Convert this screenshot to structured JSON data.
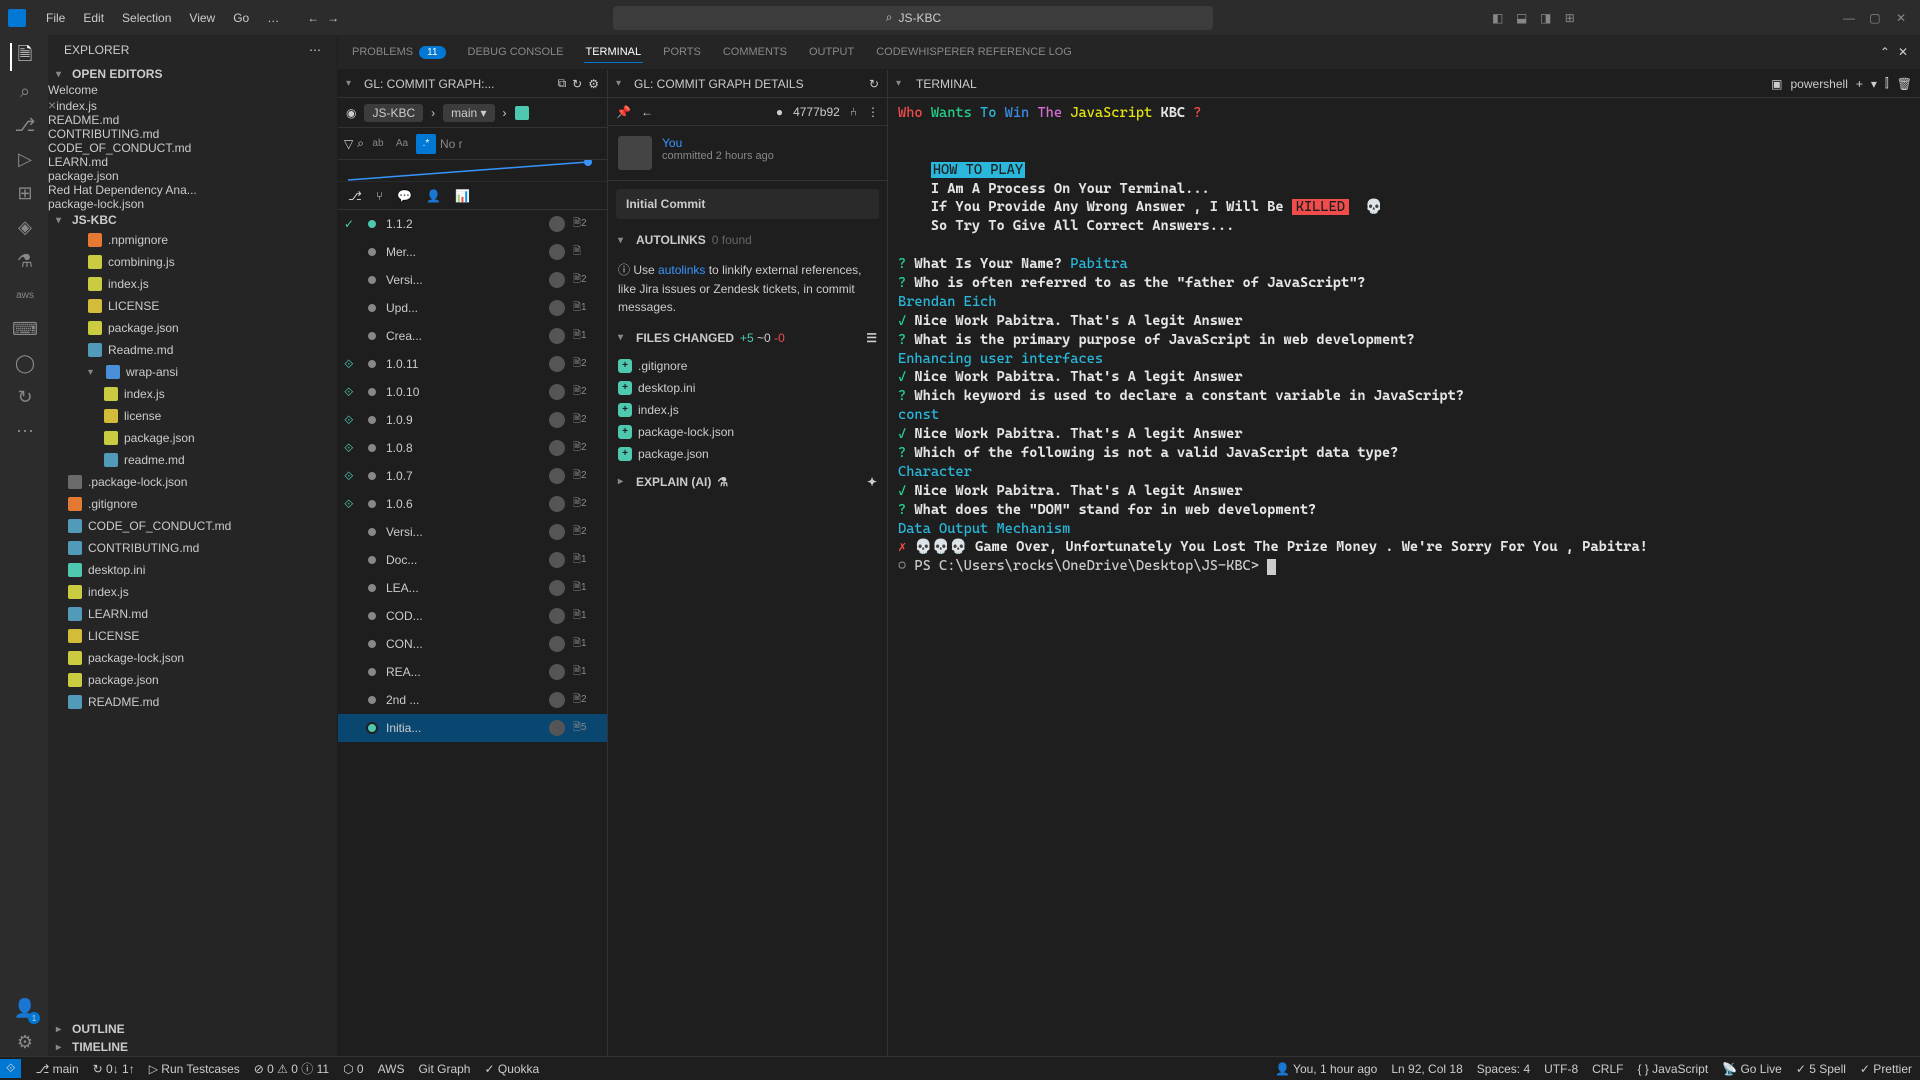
{
  "titlebar": {
    "menus": [
      "File",
      "Edit",
      "Selection",
      "View",
      "Go",
      "…"
    ],
    "search": "JS-KBC",
    "search_icon": "⌕"
  },
  "activitybar": {
    "items": [
      "files",
      "search",
      "scm",
      "debug",
      "ext",
      "remote",
      "testing",
      "aws",
      "terminal",
      "chat",
      "cloud"
    ],
    "bottom": [
      "account",
      "gear"
    ]
  },
  "explorer": {
    "title": "EXPLORER",
    "open_editors": "OPEN EDITORS",
    "open_items": [
      {
        "icon": "blue",
        "label": "Welcome",
        "close": false
      },
      {
        "icon": "js",
        "label": "index.js",
        "close": true
      },
      {
        "icon": "md",
        "label": "README.md",
        "invalid": true
      },
      {
        "icon": "md",
        "label": "CONTRIBUTING.md",
        "invalid": true
      },
      {
        "icon": "md",
        "label": "CODE_OF_CONDUCT.md",
        "invalid": true
      },
      {
        "icon": "md",
        "label": "LEARN.md",
        "invalid": true
      },
      {
        "icon": "json",
        "label": "package.json",
        "invalid": true
      },
      {
        "icon": "invalid",
        "label": "Red Hat Dependency Ana...",
        "invalid": true
      },
      {
        "icon": "json",
        "label": "package-lock.json",
        "invalid": true
      }
    ],
    "project": "JS-KBC",
    "files": [
      {
        "l": 2,
        "icon": "git",
        "label": ".npmignore"
      },
      {
        "l": 2,
        "icon": "js",
        "label": "combining.js"
      },
      {
        "l": 2,
        "icon": "js",
        "label": "index.js"
      },
      {
        "l": 2,
        "icon": "license",
        "label": "LICENSE"
      },
      {
        "l": 2,
        "icon": "json",
        "label": "package.json"
      },
      {
        "l": 2,
        "icon": "md",
        "label": "Readme.md"
      },
      {
        "l": 2,
        "chev": "▾",
        "icon": "folder",
        "label": "wrap-ansi"
      },
      {
        "l": 3,
        "icon": "js",
        "label": "index.js"
      },
      {
        "l": 3,
        "icon": "license",
        "label": "license"
      },
      {
        "l": 3,
        "icon": "json",
        "label": "package.json"
      },
      {
        "l": 3,
        "icon": "md",
        "label": "readme.md"
      },
      {
        "l": 1,
        "icon": "lock",
        "label": ".package-lock.json"
      },
      {
        "l": 1,
        "icon": "git",
        "label": ".gitignore"
      },
      {
        "l": 1,
        "icon": "md",
        "label": "CODE_OF_CONDUCT.md"
      },
      {
        "l": 1,
        "icon": "md",
        "label": "CONTRIBUTING.md"
      },
      {
        "l": 1,
        "icon": "green",
        "label": "desktop.ini"
      },
      {
        "l": 1,
        "icon": "js",
        "label": "index.js"
      },
      {
        "l": 1,
        "icon": "md",
        "label": "LEARN.md"
      },
      {
        "l": 1,
        "icon": "license",
        "label": "LICENSE"
      },
      {
        "l": 1,
        "icon": "json",
        "label": "package-lock.json"
      },
      {
        "l": 1,
        "icon": "json",
        "label": "package.json"
      },
      {
        "l": 1,
        "icon": "md",
        "label": "README.md"
      }
    ],
    "sections": {
      "outline": "OUTLINE",
      "timeline": "TIMELINE"
    }
  },
  "panel_tabs": {
    "items": [
      "PROBLEMS",
      "DEBUG CONSOLE",
      "TERMINAL",
      "PORTS",
      "COMMENTS",
      "OUTPUT",
      "CODEWHISPERER REFERENCE LOG"
    ],
    "active": 2,
    "problems_badge": "11"
  },
  "graph": {
    "title": "GL: COMMIT GRAPH:...",
    "repo": "JS-KBC",
    "branch": "main",
    "search_placeholder": "No r",
    "opts": {
      "match": "ab",
      "case": "Aa",
      "regex": ".*"
    },
    "commits": [
      {
        "msg": "1.1.2",
        "cnt": 2,
        "check": true
      },
      {
        "msg": "Mer...",
        "cnt": "",
        "av": true
      },
      {
        "msg": "Versi...",
        "cnt": 2
      },
      {
        "msg": "Upd...",
        "cnt": 1
      },
      {
        "msg": "Crea...",
        "cnt": 1
      },
      {
        "msg": "1.0.11",
        "cnt": 2,
        "link": true
      },
      {
        "msg": "1.0.10",
        "cnt": 2,
        "link": true
      },
      {
        "msg": "1.0.9",
        "cnt": 2,
        "link": true
      },
      {
        "msg": "1.0.8",
        "cnt": 2,
        "link": true
      },
      {
        "msg": "1.0.7",
        "cnt": 2,
        "link": true
      },
      {
        "msg": "1.0.6",
        "cnt": 2,
        "link": true
      },
      {
        "msg": "Versi...",
        "cnt": 2
      },
      {
        "msg": "Doc...",
        "cnt": 1
      },
      {
        "msg": "LEA...",
        "cnt": 1
      },
      {
        "msg": "COD...",
        "cnt": 1
      },
      {
        "msg": "CON...",
        "cnt": 1
      },
      {
        "msg": "REA...",
        "cnt": 1
      },
      {
        "msg": "2nd ...",
        "cnt": 2
      },
      {
        "msg": "Initia...",
        "cnt": 5,
        "sel": true
      }
    ]
  },
  "details": {
    "title": "GL: COMMIT GRAPH DETAILS",
    "hash": "4777b92",
    "author": "You",
    "time": "committed 2 hours ago",
    "commit_title": "Initial Commit",
    "autolinks": {
      "label": "AUTOLINKS",
      "count": "0 found",
      "text_pre": "ⓘ Use ",
      "link": "autolinks",
      "text_post": " to linkify external references, like Jira issues or Zendesk tickets, in commit messages."
    },
    "files": {
      "label": "FILES CHANGED",
      "stats_add": "+5",
      "stats_mod": "~0",
      "stats_del": "-0",
      "list": [
        ".gitignore",
        "desktop.ini",
        "index.js",
        "package-lock.json",
        "package.json"
      ]
    },
    "explain": "EXPLAIN (AI)"
  },
  "terminal": {
    "label": "TERMINAL",
    "shell": "powershell",
    "title_words": [
      {
        "t": "Who",
        "c": "red"
      },
      {
        "t": " Wants",
        "c": "green"
      },
      {
        "t": " To",
        "c": "cyan"
      },
      {
        "t": " Win",
        "c": "blue"
      },
      {
        "t": " The",
        "c": "mag"
      },
      {
        "t": " JavaScript",
        "c": "yellow"
      },
      {
        "t": " KBC",
        "c": "white"
      },
      {
        "t": " ?",
        "c": "red"
      }
    ],
    "howto": "HOW TO PLAY",
    "intro": [
      "I Am A Process On Your Terminal...",
      "If You Provide Any Wrong Answer , I Will Be ",
      "So Try To Give All Correct Answers..."
    ],
    "killed": "KILLED",
    "skull": "💀",
    "name_q": "What Is Your Name?",
    "name_a": "Pabitra",
    "qa": [
      {
        "q": "Who is often referred to as the \"father of JavaScript\"?",
        "a": "Brendan Eich",
        "ok": "Nice Work Pabitra. That's A legit Answer"
      },
      {
        "q": "What is the primary purpose of JavaScript in web development?",
        "a": "Enhancing user interfaces",
        "ok": "Nice Work Pabitra. That's A legit Answer"
      },
      {
        "q": "Which keyword is used to declare a constant variable in JavaScript?",
        "a": "const",
        "ok": "Nice Work Pabitra. That's A legit Answer"
      },
      {
        "q": "Which of the following is not a valid JavaScript data type?",
        "a": "Character",
        "ok": "Nice Work Pabitra. That's A legit Answer"
      },
      {
        "q": "What does the \"DOM\" stand for in web development?",
        "a": "Data Output Mechanism",
        "fail": "Game Over, Unfortunately You Lost The Prize Money . We're Sorry For You , Pabitra!"
      }
    ],
    "skulls3": "💀💀💀",
    "prompt": "PS C:\\Users\\rocks\\OneDrive\\Desktop\\JS-KBC>"
  },
  "statusbar": {
    "left": [
      {
        "icon": "⎇",
        "label": "main"
      },
      {
        "icon": "↻",
        "label": "0↓ 1↑"
      },
      {
        "icon": "▷",
        "label": "Run Testcases"
      },
      {
        "icon": "⊘",
        "label": "0 ⚠ 0 ⓘ 11"
      },
      {
        "icon": "⬡",
        "label": "0"
      },
      {
        "label": "AWS"
      },
      {
        "label": "Git Graph"
      },
      {
        "icon": "✓",
        "label": "Quokka"
      }
    ],
    "right": [
      {
        "icon": "👤",
        "label": "You, 1 hour ago"
      },
      {
        "label": "Ln 92, Col 18"
      },
      {
        "label": "Spaces: 4"
      },
      {
        "label": "UTF-8"
      },
      {
        "label": "CRLF"
      },
      {
        "label": "{ } JavaScript"
      },
      {
        "icon": "📡",
        "label": "Go Live"
      },
      {
        "icon": "✓",
        "label": "5 Spell"
      },
      {
        "icon": "✓",
        "label": "Prettier"
      }
    ]
  }
}
